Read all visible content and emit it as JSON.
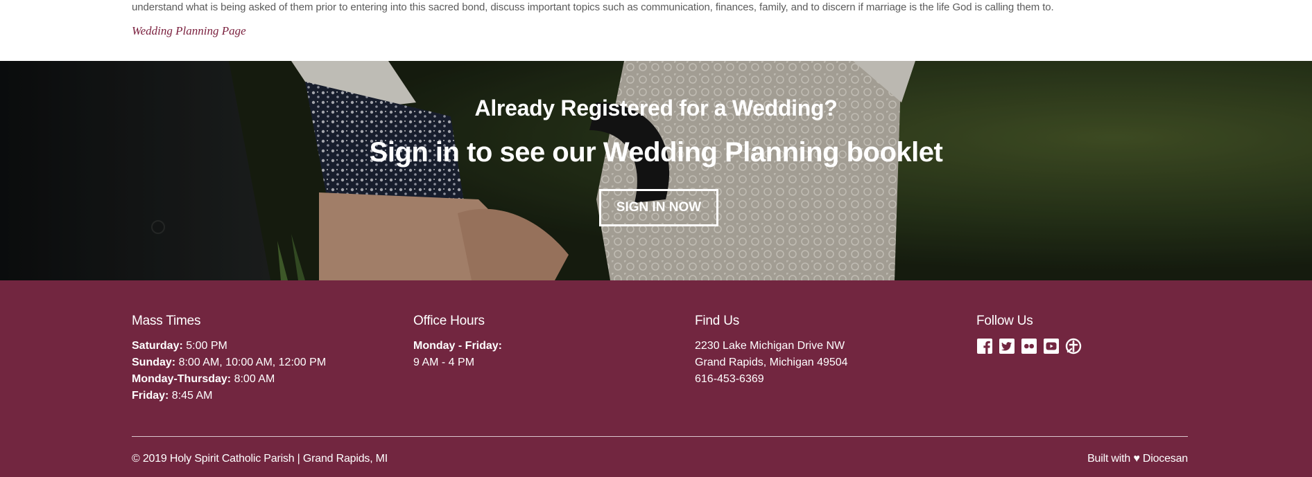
{
  "intro": {
    "text": "understand what is being asked of them prior to entering into this sacred bond, discuss important topics such as communication, finances, family, and to discern if marriage is the life God is calling them to.",
    "link_label": "Wedding Planning Page"
  },
  "hero": {
    "title": "Already Registered for a Wedding?",
    "subtitle": "Sign in to see our Wedding Planning booklet",
    "button_label": "SIGN IN NOW"
  },
  "footer": {
    "mass_times": {
      "heading": "Mass Times",
      "rows": [
        {
          "day": "Saturday:",
          "times": " 5:00 PM"
        },
        {
          "day": "Sunday:",
          "times": " 8:00 AM, 10:00 AM, 12:00 PM"
        },
        {
          "day": "Monday-Thursday:",
          "times": " 8:00 AM"
        },
        {
          "day": "Friday:",
          "times": " 8:45 AM"
        }
      ]
    },
    "office_hours": {
      "heading": "Office Hours",
      "days": "Monday - Friday:",
      "hours": "9 AM - 4 PM"
    },
    "find_us": {
      "heading": "Find Us",
      "address_line1": "2230 Lake Michigan Drive NW",
      "address_line2": "Grand Rapids, Michigan 49504",
      "phone": "616-453-6369"
    },
    "follow_us": {
      "heading": "Follow Us",
      "icons": [
        "facebook-icon",
        "twitter-icon",
        "flickr-icon",
        "youtube-icon",
        "catholic-app-icon"
      ]
    },
    "copyright": "© 2019 Holy Spirit Catholic Parish | Grand Rapids, MI",
    "built_with_prefix": "Built with ♥ ",
    "built_with_link": "Diocesan"
  },
  "colors": {
    "footer_bg": "#722640",
    "link_accent": "#7a1f3d",
    "body_text": "#5b5b5b"
  }
}
